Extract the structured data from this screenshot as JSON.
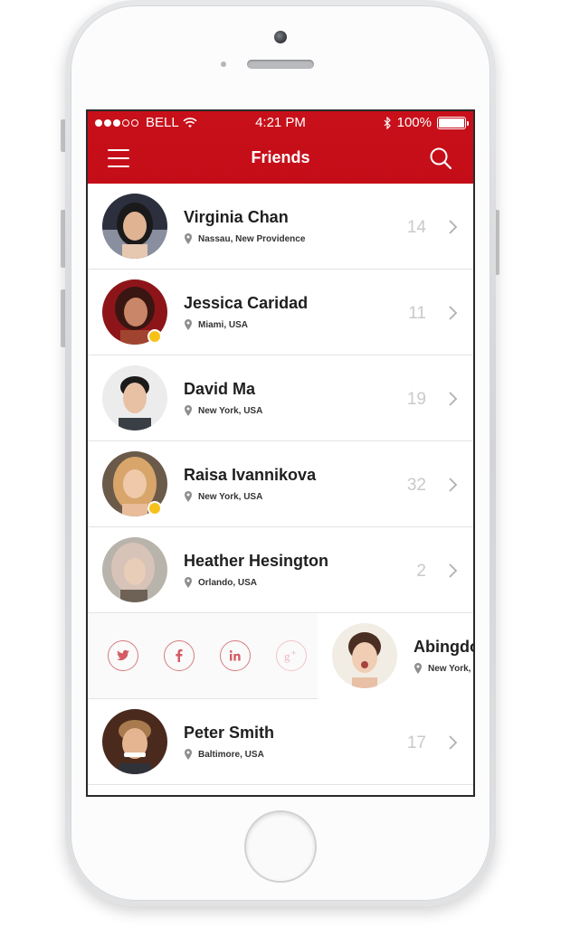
{
  "status_bar": {
    "carrier": "BELL",
    "time": "4:21 PM",
    "battery": "100%"
  },
  "nav": {
    "title": "Friends"
  },
  "friends": [
    {
      "name": "Virginia Chan",
      "location": "Nassau, New Providence",
      "count": "14"
    },
    {
      "name": "Jessica Caridad",
      "location": "Miami, USA",
      "count": "11"
    },
    {
      "name": "David Ma",
      "location": "New York, USA",
      "count": "19"
    },
    {
      "name": "Raisa Ivannikova",
      "location": "New York, USA",
      "count": "32"
    },
    {
      "name": "Heather Hesington",
      "location": "Orlando, USA",
      "count": "2"
    },
    {
      "name": "Abingdo",
      "location": "New York,",
      "count": ""
    },
    {
      "name": "Peter Smith",
      "location": "Baltimore, USA",
      "count": "17"
    }
  ],
  "social_actions": [
    "twitter-icon",
    "facebook-icon",
    "linkedin-icon",
    "google-plus-icon"
  ],
  "colors": {
    "header": "#c8101a",
    "online": "#f8c11a",
    "social": "#d45c66"
  }
}
